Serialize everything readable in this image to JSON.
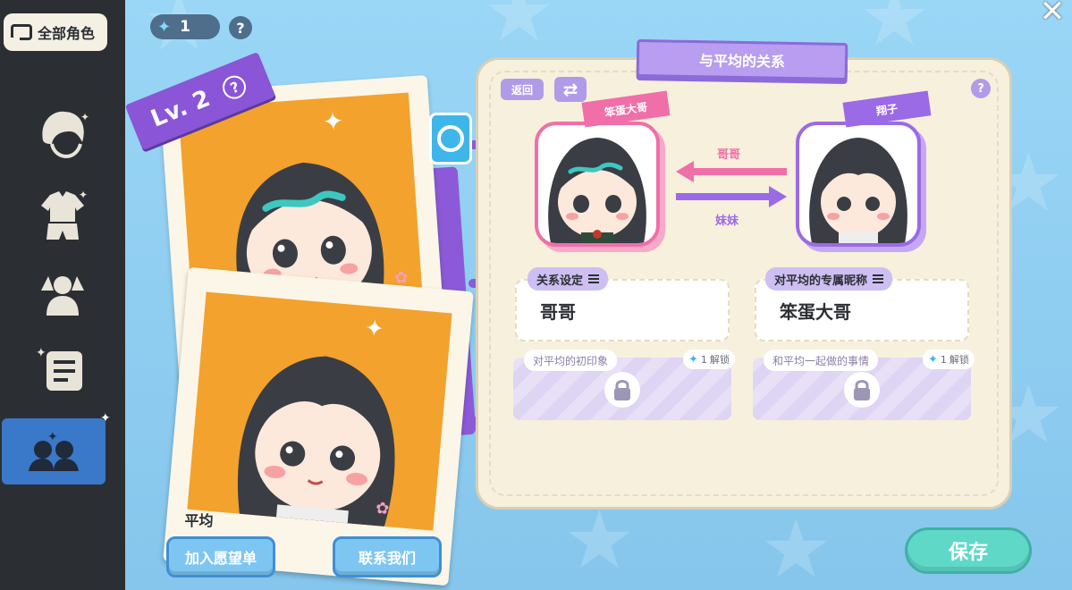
{
  "top": {
    "all_roles_label": "全部角色",
    "currency_value": "1",
    "help_symbol": "?",
    "close_symbol": "✕"
  },
  "sidebar": {
    "items": [
      {
        "name": "hair",
        "icon": "hair-icon"
      },
      {
        "name": "outfit",
        "icon": "outfit-icon"
      },
      {
        "name": "pose",
        "icon": "pose-icon"
      },
      {
        "name": "story",
        "icon": "dialogue-icon"
      },
      {
        "name": "relations",
        "icon": "relation-icon",
        "active": true
      }
    ]
  },
  "card": {
    "level_label": "Lv. 2",
    "help_symbol": "?",
    "character_name": "平均"
  },
  "buttons": {
    "wishlist": "加入愿望单",
    "contact": "联系我们",
    "save": "保存"
  },
  "relation": {
    "title": "与平均的关系",
    "back": "返回",
    "help_symbol": "?",
    "left_tag": "笨蛋大哥",
    "right_tag": "翔子",
    "top_relation": "哥哥",
    "bottom_relation": "妹妹",
    "fields": {
      "relation_setting_label": "关系设定",
      "relation_setting_value": "哥哥",
      "nickname_label": "对平均的专属昵称",
      "nickname_value": "笨蛋大哥"
    },
    "locked": {
      "first_impression_label": "对平均的初印象",
      "together_label": "和平均一起做的事情",
      "cost": "1",
      "unlock_text": "解锁"
    }
  },
  "colors": {
    "accent_purple": "#8c5ad8",
    "pink": "#f06fa8",
    "teal": "#5fd8c8",
    "sidebar": "#2b2f33"
  }
}
